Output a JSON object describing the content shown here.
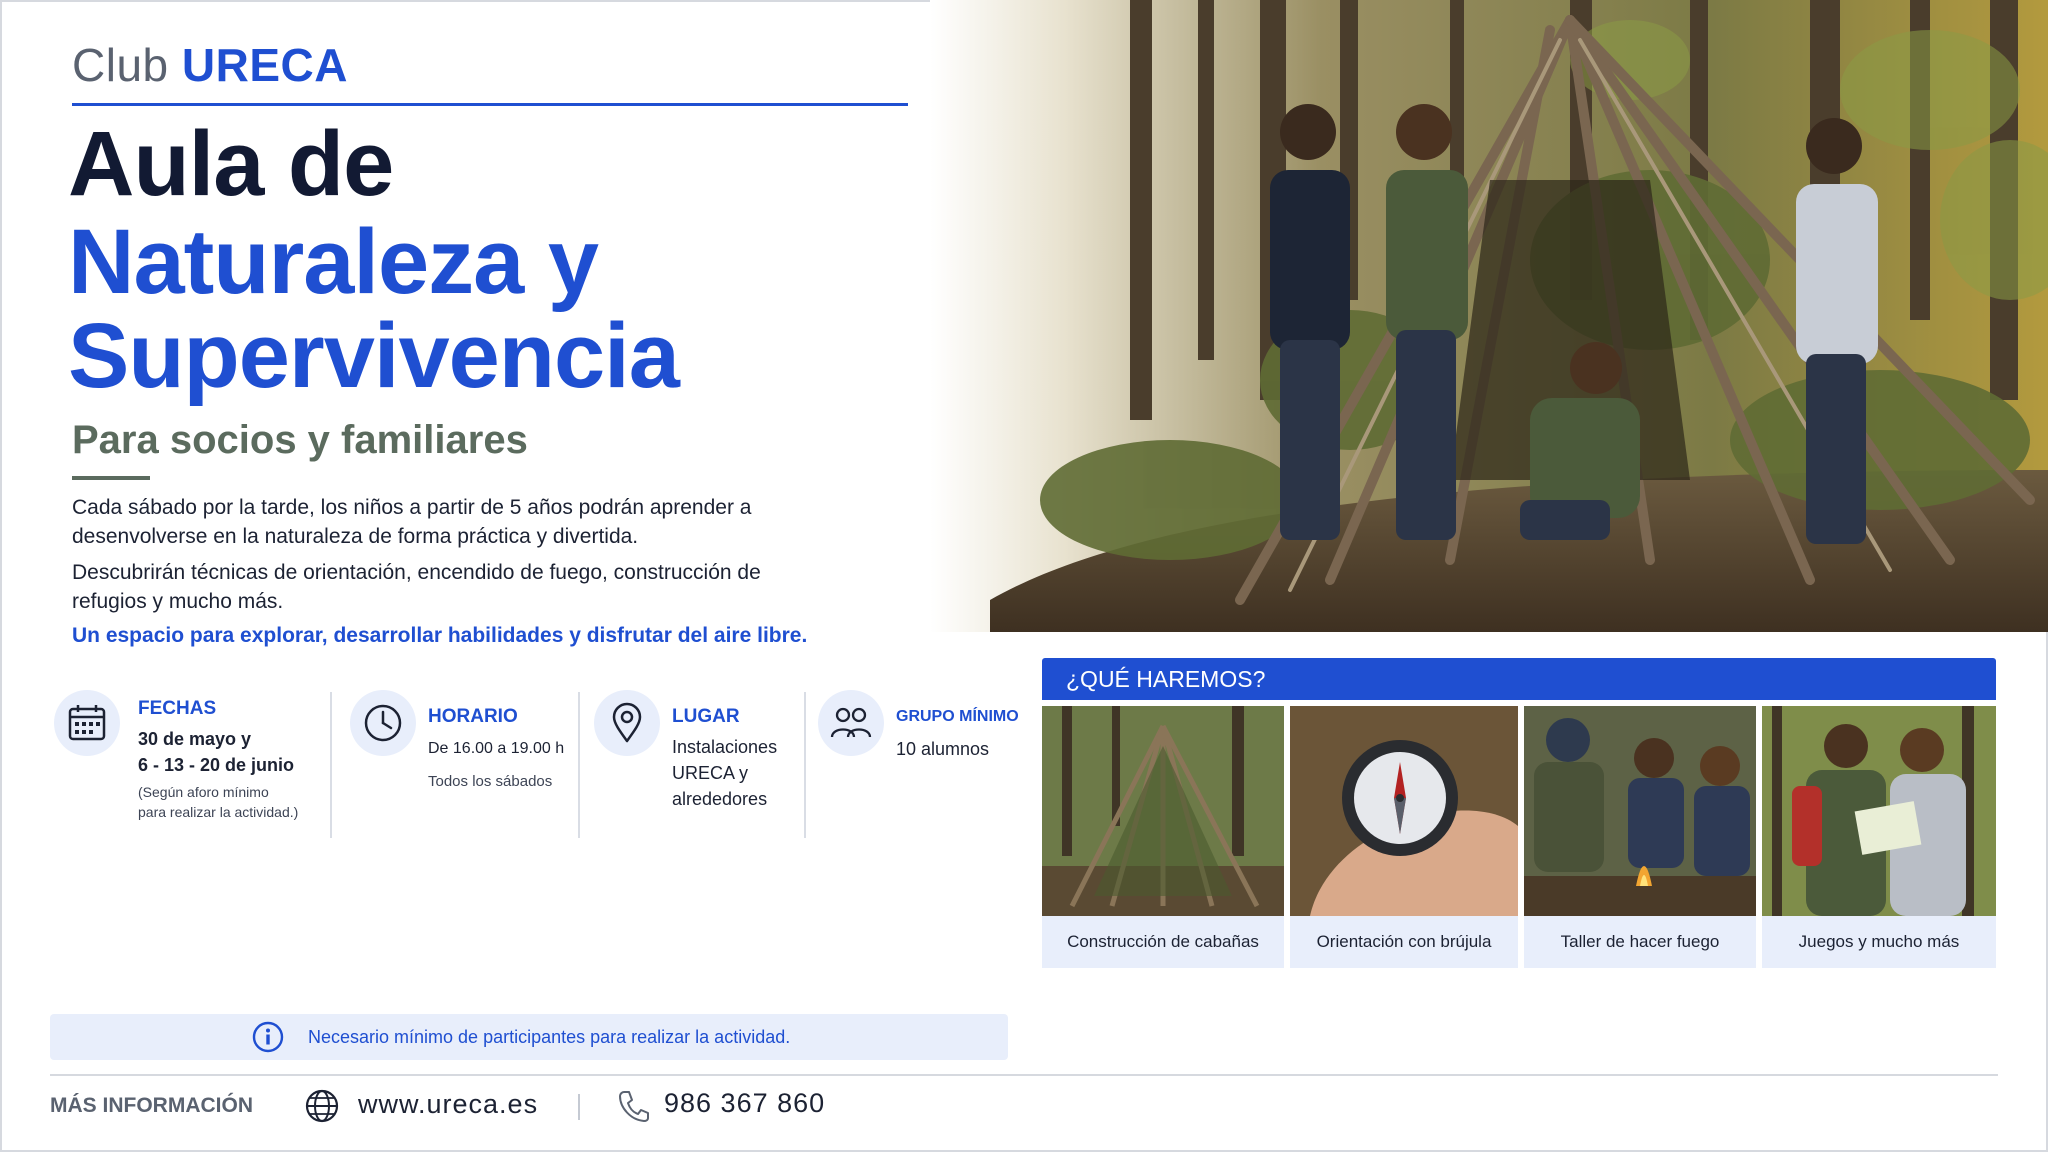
{
  "header": {
    "club_prefix": "Club",
    "club_name": "URECA",
    "title_line1": "Aula de",
    "title_line2": "Naturaleza y",
    "title_line3": "Supervivencia",
    "subtitle": "Para socios y familiares"
  },
  "intro": {
    "paragraph1": "Cada sábado por la tarde, los niños a partir de 5 años podrán aprender a desenvolverse en la naturaleza de forma práctica y divertida.",
    "paragraph2": "Descubrirán técnicas de orientación, encendido de fuego, construcción de refugios y mucho más.",
    "tagline": "Un espacio para explorar, desarrollar habilidades y disfrutar del aire libre."
  },
  "info": {
    "fechas": {
      "icon": "calendar-icon",
      "label": "FECHAS",
      "line1": "30 de mayo y",
      "line2": "6 - 13 - 20 de junio",
      "note1": "(Según aforo mínimo",
      "note2": "para realizar la actividad.)"
    },
    "horario": {
      "icon": "clock-icon",
      "label": "HORARIO",
      "line1": "De 16.00 a 19.00 h",
      "line2": "Todos los sábados"
    },
    "lugar": {
      "icon": "map-pin-icon",
      "label": "LUGAR",
      "line1": "Instalaciones",
      "line2": "URECA y",
      "line3": "alrededores"
    },
    "grupo": {
      "icon": "group-icon",
      "label": "GRUPO MÍNIMO",
      "line1": "10 alumnos"
    }
  },
  "activities": {
    "heading": "¿QUÉ HAREMOS?",
    "items": [
      {
        "caption": "Construcción de cabañas",
        "image": "branch-shelter-photo"
      },
      {
        "caption": "Orientación con brújula",
        "image": "compass-photo"
      },
      {
        "caption": "Taller de hacer fuego",
        "image": "fire-workshop-photo"
      },
      {
        "caption": "Juegos y mucho más",
        "image": "kids-map-photo"
      }
    ]
  },
  "notice": {
    "icon": "info-icon",
    "text": "Necesario mínimo de participantes para realizar la actividad."
  },
  "footer": {
    "label": "MÁS INFORMACIÓN",
    "web_icon": "globe-icon",
    "website": "www.ureca.es",
    "phone_icon": "phone-icon",
    "phone": "986 367 860"
  },
  "colors": {
    "brand_blue": "#1f4fd1",
    "title_dark": "#121a33",
    "subtitle_green": "#5b6b5e",
    "panel_light": "#e8eefb"
  }
}
